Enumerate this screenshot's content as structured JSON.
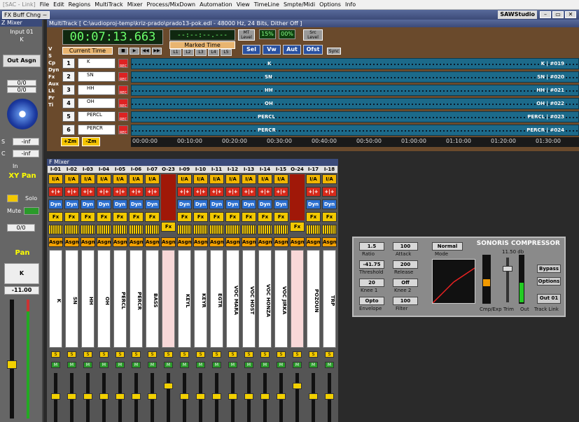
{
  "app": {
    "name": "[SAC - Link]",
    "brand": "SAWStudio"
  },
  "menu": [
    "File",
    "Edit",
    "Regions",
    "MultiTrack",
    "Mixer",
    "Process/MixDown",
    "Automation",
    "View",
    "TimeLine",
    "Smpte/Midi",
    "Options",
    "Info"
  ],
  "fxbar": {
    "button": "FX Buff Chng ~"
  },
  "zmixer": {
    "title": "Z Mixer",
    "input": "Input 01",
    "k": "K",
    "out_asgn": "Out Asgn",
    "vals": [
      "0/0",
      "0/0"
    ],
    "s_label": "S",
    "c_label": "C",
    "s_val": "-inf",
    "c_val": "-inf",
    "in_label": "In",
    "xy_pan": "XY Pan",
    "solo": "Solo",
    "mute": "Mute",
    "pan_val": "0/0",
    "pan": "Pan",
    "name": "K",
    "level": "-11.00"
  },
  "multitrack": {
    "title": "MultiTrack  [ C:\\audioproj-temp\\kriz-prado\\prado13-pok.edl - 48000 Hz, 24 Bits, Dither Off ]",
    "time": "00:07:13.663",
    "marked_display": "--:--:--.---",
    "current_time_label": "Current Time",
    "marked_time_label": "Marked Time",
    "mt_level": "MT Level",
    "pct1": "15%",
    "pct2": "00%",
    "src_level": "Src Level",
    "sync": "Sync",
    "buttons": [
      "Sel",
      "Vw",
      "Aut",
      "Ofst"
    ],
    "tp": [
      "L1",
      "L2",
      "L3",
      "L4",
      "L5"
    ],
    "side_labels": [
      "V",
      "S",
      "Cp",
      "Dyn",
      "Fx",
      "Aux",
      "Lk",
      "Pr",
      "Ti"
    ],
    "zoom_in": "+Zm",
    "zoom_out": "-Zm",
    "tracks": [
      {
        "num": "1",
        "name": "K",
        "center": "K",
        "right": "K | #019"
      },
      {
        "num": "2",
        "name": "SN",
        "center": "SN",
        "right": "SN | #020"
      },
      {
        "num": "3",
        "name": "HH",
        "center": "HH",
        "right": "HH | #021"
      },
      {
        "num": "4",
        "name": "OH",
        "center": "OH",
        "right": "OH | #022"
      },
      {
        "num": "5",
        "name": "PERCL",
        "center": "PERCL",
        "right": "PERCL | #023"
      },
      {
        "num": "6",
        "name": "PERCR",
        "center": "PERCR",
        "right": "PERCR | #024"
      }
    ],
    "ruler": [
      "00:00:00",
      "00:10:00",
      "00:20:00",
      "00:30:00",
      "00:40:00",
      "00:50:00",
      "01:00:00",
      "01:10:00",
      "01:20:00",
      "01:30:00"
    ]
  },
  "fmixer": {
    "title": "F Mixer",
    "strips": [
      {
        "id": "I-01",
        "name": "K"
      },
      {
        "id": "I-02",
        "name": "SN"
      },
      {
        "id": "I-03",
        "name": "HH"
      },
      {
        "id": "I-04",
        "name": "OH"
      },
      {
        "id": "I-05",
        "name": "PERCL"
      },
      {
        "id": "I-06",
        "name": "PERCR"
      },
      {
        "id": "I-07",
        "name": "BASS"
      },
      {
        "id": "O-23",
        "name": ""
      },
      {
        "id": "I-09",
        "name": "KEYL"
      },
      {
        "id": "I-10",
        "name": "KEYR"
      },
      {
        "id": "I-11",
        "name": "EGTR"
      },
      {
        "id": "I-12",
        "name": "VOC MARA"
      },
      {
        "id": "I-13",
        "name": "VOC HOST"
      },
      {
        "id": "I-14",
        "name": "VOC HONZA"
      },
      {
        "id": "I-15",
        "name": "VOC JIRKA"
      },
      {
        "id": "O-24",
        "name": ""
      },
      {
        "id": "I-17",
        "name": "POZOUN"
      },
      {
        "id": "I-18",
        "name": "TRP"
      }
    ],
    "row_labels": {
      "ia": "I/A",
      "pan": "+|+",
      "dyn": "Dyn",
      "fx": "Fx",
      "eq": "EQ",
      "asgn": "Asgn",
      "solo": "S",
      "mute": "M"
    }
  },
  "compressor": {
    "title": "SONORIS COMPRESSOR",
    "ratio": "1.5",
    "ratio_label": "Ratio",
    "attack": "100",
    "attack_label": "Attack",
    "threshold": "-41.75",
    "threshold_label": "Threshold",
    "release": "200",
    "release_label": "Release",
    "knee1": "20",
    "knee1_label": "Knee 1",
    "knee2": "Off",
    "knee2_label": "Knee 2",
    "envelope": "Opto",
    "envelope_label": "Envelope",
    "filter": "100",
    "filter_label": "Filter",
    "mode": "Normal",
    "mode_label": "Mode",
    "gain": "11.50 db",
    "cmp_exp": "Cmp/Exp",
    "trim": "Trim",
    "out": "Out",
    "bypass": "Bypass",
    "options": "Options",
    "out01": "Out 01",
    "track_link": "Track Link"
  }
}
